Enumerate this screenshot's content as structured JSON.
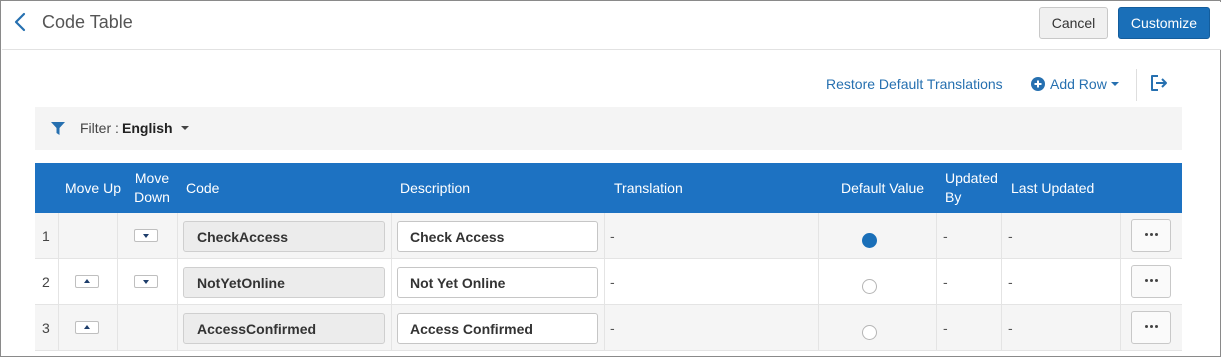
{
  "header": {
    "title": "Code Table",
    "cancel_label": "Cancel",
    "customize_label": "Customize"
  },
  "toolbar": {
    "restore_label": "Restore Default Translations",
    "add_row_label": "Add Row"
  },
  "filter": {
    "label": "Filter :",
    "value": "English"
  },
  "table": {
    "columns": {
      "move_up": "Move Up",
      "move_down": "Move Down",
      "code": "Code",
      "description": "Description",
      "translation": "Translation",
      "default_value": "Default Value",
      "updated_by": "Updated By",
      "last_updated": "Last Updated"
    },
    "rows": [
      {
        "num": "1",
        "code": "CheckAccess",
        "description": "Check Access",
        "translation": "-",
        "default": true,
        "updated_by": "-",
        "last_updated": "-",
        "can_move_up": false,
        "can_move_down": true
      },
      {
        "num": "2",
        "code": "NotYetOnline",
        "description": "Not Yet Online",
        "translation": "-",
        "default": false,
        "updated_by": "-",
        "last_updated": "-",
        "can_move_up": true,
        "can_move_down": true
      },
      {
        "num": "3",
        "code": "AccessConfirmed",
        "description": "Access Confirmed",
        "translation": "-",
        "default": false,
        "updated_by": "-",
        "last_updated": "-",
        "can_move_up": true,
        "can_move_down": false
      }
    ]
  },
  "colors": {
    "accent": "#1a6fb8",
    "header_bg": "#1d72c2",
    "link": "#2670b0"
  },
  "icons": {
    "back": "chevron-left-icon",
    "add": "plus-circle-icon",
    "export": "export-icon",
    "filter": "filter-icon",
    "actions": "ellipsis-icon"
  }
}
